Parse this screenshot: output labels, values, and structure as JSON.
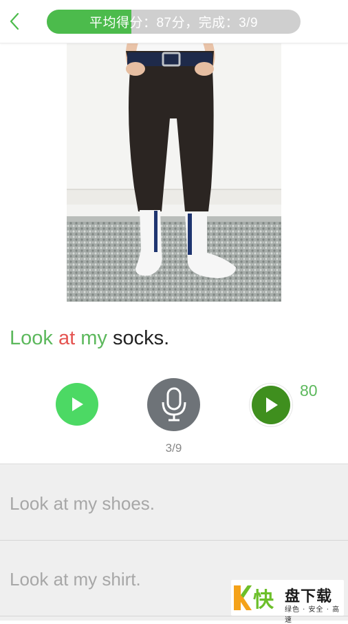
{
  "header": {
    "back_icon": "chevron-left-icon",
    "progress_text": "平均得分：87分，完成：3/9",
    "completed": 3,
    "total": 9,
    "average_score": 87
  },
  "sentence": {
    "words": [
      {
        "text": "Look",
        "status": "good"
      },
      {
        "text": "at",
        "status": "bad"
      },
      {
        "text": "my",
        "status": "good"
      },
      {
        "text": "socks.",
        "status": "neutral"
      }
    ]
  },
  "controls": {
    "play_icon": "play-icon",
    "mic_icon": "microphone-icon",
    "replay_icon": "play-recording-icon",
    "counter": "3/9",
    "score": "80"
  },
  "list": {
    "items": [
      "Look at my shoes.",
      "Look at my shirt."
    ]
  },
  "watermark": {
    "brand": "盘下载",
    "kuai": "快",
    "tagline": "绿色 · 安全 · 高速"
  },
  "colors": {
    "accent_green": "#4cbb4c",
    "word_good": "#5cb85c",
    "word_bad": "#e55451",
    "play_green": "#4cd964",
    "mic_gray": "#6e7378",
    "record_green": "#3f8f1e"
  }
}
